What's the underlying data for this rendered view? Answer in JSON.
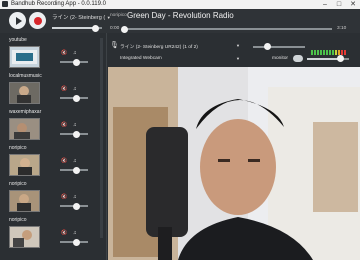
{
  "window": {
    "title": "Bandhub Recording App - 0.0.119.0"
  },
  "topbar": {
    "input_label": "ライン (2- Steinberg (",
    "track_user": "noripico",
    "track_title": "Green Day - Revolution Radio",
    "time_current": "0:00",
    "time_total": "3:10",
    "input_volume": 0.85,
    "playback_progress": 0.0
  },
  "sidebar": {
    "users": [
      {
        "name": "youtube",
        "volume": 0.6
      },
      {
        "name": "localmusmusic",
        "volume": 0.6
      },
      {
        "name": "waxemiphaxar",
        "volume": 0.6
      },
      {
        "name": "noripico",
        "volume": 0.6
      },
      {
        "name": "noripico",
        "volume": 0.6
      },
      {
        "name": "noripico",
        "volume": 0.6
      }
    ]
  },
  "main": {
    "audio_input": "ライン (2- Steinberg UR242) (1 of 2)",
    "video_input": "Integrated Webcam",
    "monitor_label": "monitor",
    "monitor_level": 0.75,
    "mic_gain": 0.25
  },
  "colors": {
    "accent_red": "#d7262b",
    "meter_green": "#4cc24a",
    "meter_red": "#e53935"
  }
}
